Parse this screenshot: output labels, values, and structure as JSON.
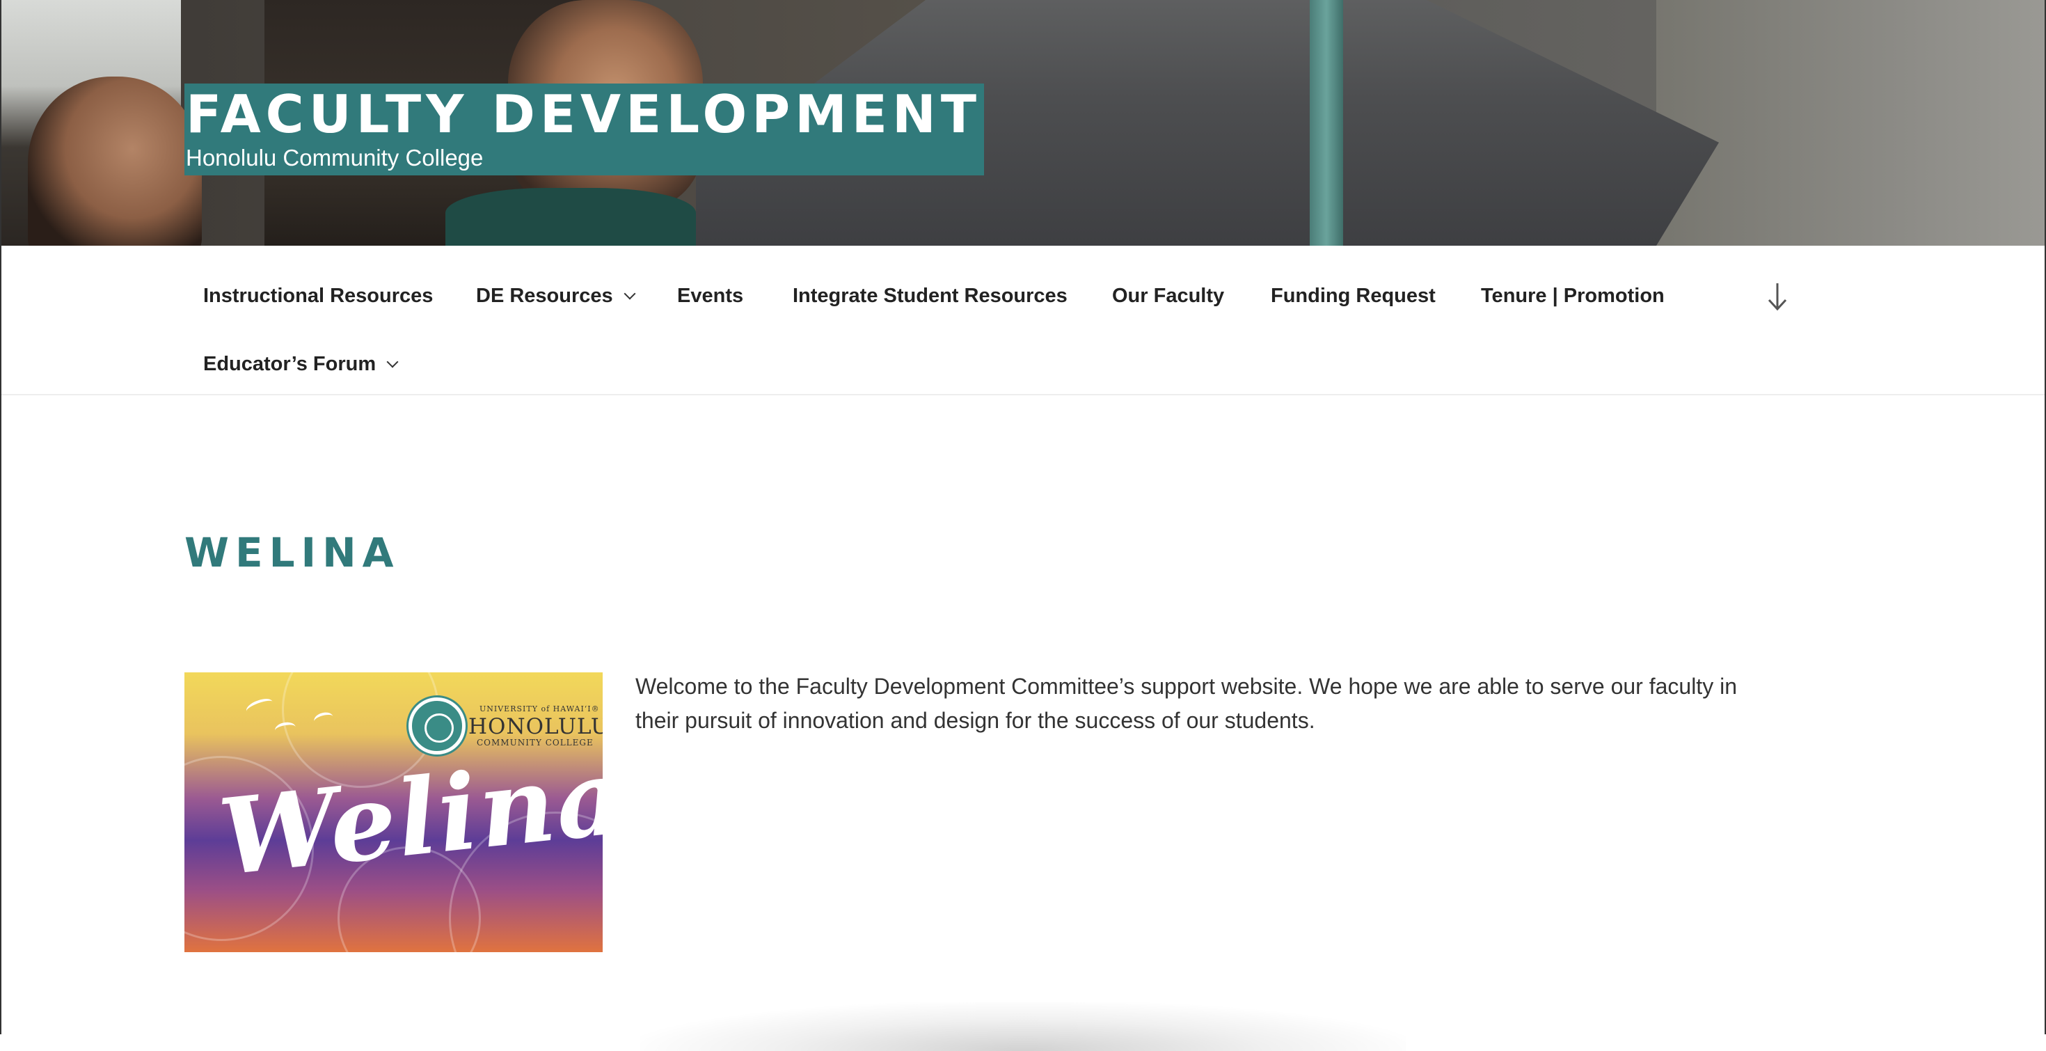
{
  "site": {
    "title": "FACULTY DEVELOPMENT",
    "description": "Honolulu Community College"
  },
  "nav": {
    "items": [
      {
        "label": "Instructional Resources",
        "has_submenu": false
      },
      {
        "label": "DE Resources",
        "has_submenu": true
      },
      {
        "label": "Events",
        "has_submenu": false
      },
      {
        "label": "Integrate Student Resources",
        "has_submenu": false
      },
      {
        "label": "Our Faculty",
        "has_submenu": false
      },
      {
        "label": "Funding Request",
        "has_submenu": false
      },
      {
        "label": "Tenure | Promotion",
        "has_submenu": false
      },
      {
        "label": "Educator’s Forum",
        "has_submenu": true
      }
    ],
    "scroll_icon": "arrow-down-icon"
  },
  "page": {
    "title": "WELINA",
    "welcome_text": "Welcome to the Faculty Development Committee’s support website. We hope we are able to serve our faculty in their pursuit of innovation and design for the success of our students."
  },
  "image": {
    "word": "Welina",
    "uh_text": "UNIVERSITY of HAWAI‘I®",
    "college_name": "HONOLULU",
    "college_sub": "COMMUNITY COLLEGE"
  },
  "colors": {
    "accent": "#317a7b",
    "text": "#333333",
    "nav_text": "#222222"
  }
}
